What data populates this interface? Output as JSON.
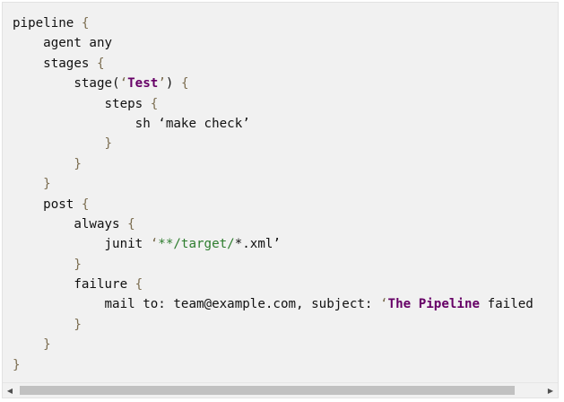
{
  "code": {
    "lines": [
      [
        {
          "t": "pipeline ",
          "c": "kw"
        },
        {
          "t": "{",
          "c": "brace"
        }
      ],
      [
        {
          "t": "    agent any",
          "c": "kw"
        }
      ],
      [
        {
          "t": "    stages ",
          "c": "kw"
        },
        {
          "t": "{",
          "c": "brace"
        }
      ],
      [
        {
          "t": "        stage(",
          "c": "kw"
        },
        {
          "t": "‘",
          "c": "quote"
        },
        {
          "t": "Test",
          "c": "bold"
        },
        {
          "t": "’",
          "c": "quote"
        },
        {
          "t": ") ",
          "c": "punct"
        },
        {
          "t": "{",
          "c": "brace"
        }
      ],
      [
        {
          "t": "            steps ",
          "c": "kw"
        },
        {
          "t": "{",
          "c": "brace"
        }
      ],
      [
        {
          "t": "                sh ‘make check’",
          "c": "kw"
        }
      ],
      [
        {
          "t": "            }",
          "c": "brace"
        }
      ],
      [
        {
          "t": "        }",
          "c": "brace"
        }
      ],
      [
        {
          "t": "    }",
          "c": "brace"
        }
      ],
      [
        {
          "t": "    post ",
          "c": "kw"
        },
        {
          "t": "{",
          "c": "brace"
        }
      ],
      [
        {
          "t": "        always ",
          "c": "kw"
        },
        {
          "t": "{",
          "c": "brace"
        }
      ],
      [
        {
          "t": "            junit ",
          "c": "kw"
        },
        {
          "t": "‘",
          "c": "quote"
        },
        {
          "t": "**/target/",
          "c": "path"
        },
        {
          "t": "*.xml’",
          "c": "kw"
        }
      ],
      [
        {
          "t": "        }",
          "c": "brace"
        }
      ],
      [
        {
          "t": "        failure ",
          "c": "kw"
        },
        {
          "t": "{",
          "c": "brace"
        }
      ],
      [
        {
          "t": "            mail to: team@example.com, subject: ",
          "c": "kw"
        },
        {
          "t": "‘",
          "c": "quote"
        },
        {
          "t": "The Pipeline",
          "c": "bold"
        },
        {
          "t": " failed",
          "c": "kw"
        }
      ],
      [
        {
          "t": "        }",
          "c": "brace"
        }
      ],
      [
        {
          "t": "    }",
          "c": "brace"
        }
      ],
      [
        {
          "t": "}",
          "c": "brace"
        }
      ]
    ]
  },
  "scrollbar": {
    "left_arrow_icon": "triangle-left-icon",
    "right_arrow_icon": "triangle-right-icon",
    "left_glyph": "◀",
    "right_glyph": "▶"
  }
}
